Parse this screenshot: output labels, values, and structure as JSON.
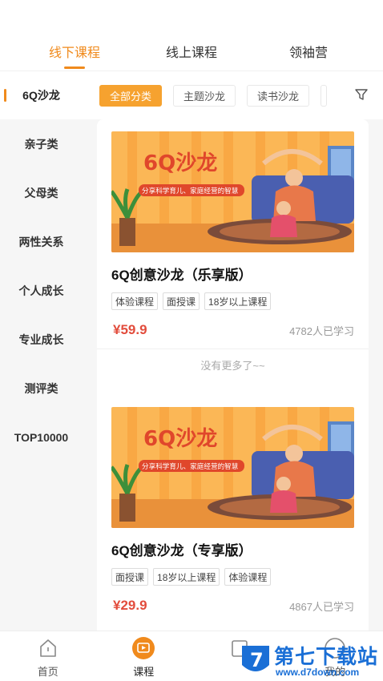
{
  "top_tabs": [
    {
      "label": "线下课程",
      "active": true
    },
    {
      "label": "线上课程",
      "active": false
    },
    {
      "label": "领袖营",
      "active": false
    }
  ],
  "sidebar": {
    "items": [
      {
        "label": "6Q沙龙",
        "active": true
      },
      {
        "label": "亲子类"
      },
      {
        "label": "父母类"
      },
      {
        "label": "两性关系"
      },
      {
        "label": "个人成长"
      },
      {
        "label": "专业成长"
      },
      {
        "label": "测评类"
      },
      {
        "label": "TOP10000"
      }
    ]
  },
  "filters": {
    "chips": [
      {
        "label": "全部分类",
        "active": true
      },
      {
        "label": "主题沙龙"
      },
      {
        "label": "读书沙龙"
      }
    ],
    "filter_icon": "funnel-icon"
  },
  "courses": [
    {
      "banner_title": "6Q沙龙",
      "banner_subtitle": "分享科学育儿、家庭经营的智慧",
      "title": "6Q创意沙龙（乐享版）",
      "tags": [
        "体验课程",
        "面授课",
        "18岁以上课程"
      ],
      "price": "¥59.9",
      "learners": "4782人已学习",
      "footer": "没有更多了~~"
    },
    {
      "banner_title": "6Q沙龙",
      "banner_subtitle": "分享科学育儿、家庭经营的智慧",
      "title": "6Q创意沙龙（专享版）",
      "tags": [
        "面授课",
        "18岁以上课程",
        "体验课程"
      ],
      "price": "¥29.9",
      "learners": "4867人已学习"
    }
  ],
  "bottom_nav": [
    {
      "label": "首页",
      "icon": "home-icon"
    },
    {
      "label": "课程",
      "icon": "play-icon",
      "active": true
    },
    {
      "label": "",
      "icon": "book-icon"
    },
    {
      "label": "我的",
      "icon": "profile-icon"
    }
  ],
  "watermark": {
    "text": "第七下载站",
    "url": "www.d7down.com"
  },
  "colors": {
    "accent": "#f08a1c",
    "price": "#e24c3c",
    "chip_active": "#f6a22f",
    "watermark": "#1a6fd6"
  }
}
